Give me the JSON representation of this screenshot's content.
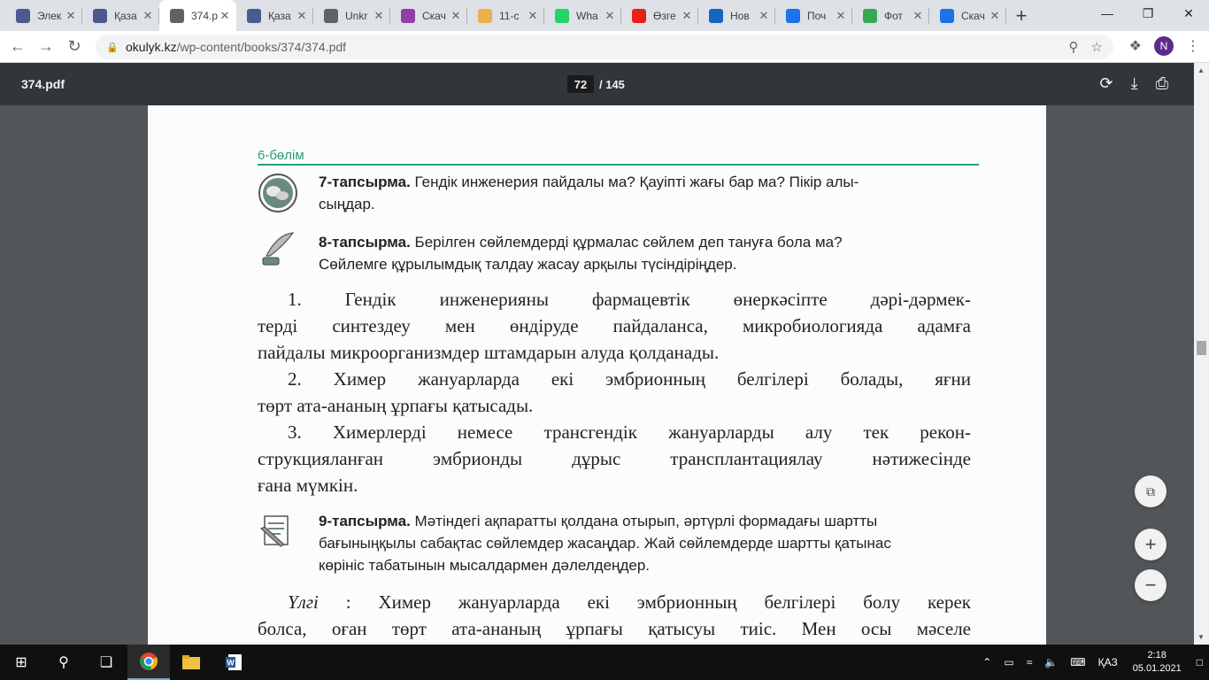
{
  "browser": {
    "tabs": [
      {
        "title": "Элек",
        "icon": "book-icon",
        "color": "#4a5a8c"
      },
      {
        "title": "Қаза",
        "icon": "book-icon",
        "color": "#4a5a8c"
      },
      {
        "title": "374.p",
        "icon": "globe-icon",
        "color": "#5f6368",
        "active": true
      },
      {
        "title": "Қаза",
        "icon": "book-icon",
        "color": "#4a5a8c"
      },
      {
        "title": "Unkr",
        "icon": "globe-icon",
        "color": "#5f6368"
      },
      {
        "title": "Скач",
        "icon": "app-icon",
        "color": "#8e3fa8"
      },
      {
        "title": "11-с",
        "icon": "coin-icon",
        "color": "#e8b24a"
      },
      {
        "title": "Wha",
        "icon": "whatsapp-icon",
        "color": "#25d366"
      },
      {
        "title": "Өзге",
        "icon": "youtube-icon",
        "color": "#e62117"
      },
      {
        "title": "Нов",
        "icon": "mail-icon",
        "color": "#1565c0"
      },
      {
        "title": "Поч",
        "icon": "mail-icon",
        "color": "#1a73e8"
      },
      {
        "title": "Фот",
        "icon": "drive-icon",
        "color": "#34a853"
      },
      {
        "title": "Скач",
        "icon": "download-icon",
        "color": "#1a73e8"
      }
    ],
    "url_host": "okulyk.kz",
    "url_path": "/wp-content/books/374/374.pdf",
    "profile_initial": "N"
  },
  "pdf": {
    "filename": "374.pdf",
    "current_page": "72",
    "total_pages": "/ 145"
  },
  "page": {
    "section": "6-бөлім",
    "task7": {
      "label": "7-тапсырма.",
      "text": " Гендік инженерия пайдалы ма? Қауіпті жағы бар ма? Пікір алы-",
      "text2": "сыңдар."
    },
    "task8": {
      "label": "8-тапсырма.",
      "text": " Берілген сөйлемдерді құрмалас сөйлем деп тануға бола ма?",
      "text2": "Сөйлемге құрылымдық талдау жасау арқылы түсіндіріңдер."
    },
    "sentences": [
      "1. Гендік инженерияны фармацевтік өнеркәсіпте дәрі-дәрмек-",
      "терді синтездеу мен өндіруде пайдаланса, микробиологияда адамға",
      "пайдалы микроорганизмдер штамдарын алуда қолданады.",
      "2. Химер жануарларда екі эмбрионның белгілері болады, яғни",
      "төрт ата-ананың ұрпағы қатысады.",
      "3. Химерлерді немесе трансгендік жануарларды алу тек рекон-",
      "струкцияланған эмбрионды дұрыс трансплантациялау нәтижесінде",
      "ғана мүмкін."
    ],
    "task9": {
      "label": "9-тапсырма.",
      "text": " Мәтіндегі ақпаратты қолдана отырып, әртүрлі формадағы шартты",
      "text2": "бағыныңқылы сабақтас сөйлемдер жасаңдар. Жай сөйлемдерде шартты қатынас",
      "text3": "көрініс табатынын мысалдармен дәлелдеңдер."
    },
    "example": {
      "label": "Үлгі",
      "line1": " : Химер жануарларда екі эмбрионның белгілері болу керек",
      "line2": "болса, оған төрт ата-ананың ұрпағы қатысуы тиіс. Мен осы мәселе"
    }
  },
  "taskbar": {
    "lang": "ҚАЗ",
    "time": "2:18",
    "date": "05.01.2021"
  }
}
